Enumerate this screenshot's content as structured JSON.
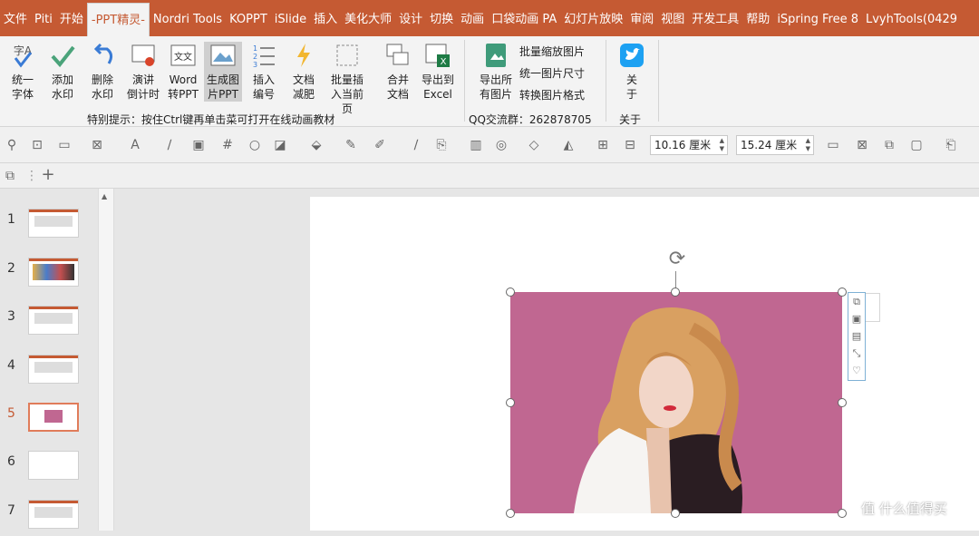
{
  "tabs": [
    {
      "label": "文件",
      "active": false
    },
    {
      "label": "Piti",
      "active": false
    },
    {
      "label": "开始",
      "active": false
    },
    {
      "label": "-PPT精灵-",
      "active": true
    },
    {
      "label": "Nordri Tools",
      "active": false
    },
    {
      "label": "KOPPT",
      "active": false
    },
    {
      "label": "iSlide",
      "active": false
    },
    {
      "label": "插入",
      "active": false
    },
    {
      "label": "美化大师",
      "active": false
    },
    {
      "label": "设计",
      "active": false
    },
    {
      "label": "切换",
      "active": false
    },
    {
      "label": "动画",
      "active": false
    },
    {
      "label": "口袋动画 PA",
      "active": false
    },
    {
      "label": "幻灯片放映",
      "active": false
    },
    {
      "label": "审阅",
      "active": false
    },
    {
      "label": "视图",
      "active": false
    },
    {
      "label": "开发工具",
      "active": false
    },
    {
      "label": "帮助",
      "active": false
    },
    {
      "label": "iSpring Free 8",
      "active": false
    },
    {
      "label": "LvyhTools(0429",
      "active": false
    }
  ],
  "ribbon": {
    "buttons": [
      {
        "l1": "统一",
        "l2": "字体",
        "icon": "unify-font-icon"
      },
      {
        "l1": "添加",
        "l2": "水印",
        "icon": "add-watermark-icon"
      },
      {
        "l1": "删除",
        "l2": "水印",
        "icon": "delete-watermark-icon"
      },
      {
        "l1": "演讲",
        "l2": "倒计时",
        "icon": "countdown-icon"
      },
      {
        "l1": "Word",
        "l2": "转PPT",
        "icon": "word-to-ppt-icon"
      },
      {
        "l1": "生成图",
        "l2": "片PPT",
        "icon": "image-ppt-icon"
      },
      {
        "l1": "插入",
        "l2": "编号",
        "icon": "insert-number-icon"
      },
      {
        "l1": "文档",
        "l2": "减肥",
        "icon": "slim-doc-icon"
      },
      {
        "l1": "批量插",
        "l2": "入当前页",
        "icon": "batch-insert-icon"
      },
      {
        "l1": "合并",
        "l2": "文档",
        "icon": "merge-doc-icon"
      },
      {
        "l1": "导出到",
        "l2": "Excel",
        "icon": "export-excel-icon"
      },
      {
        "l1": "导出所",
        "l2": "有图片",
        "icon": "export-images-icon"
      },
      {
        "l1": "关",
        "l2": "于",
        "icon": "twitter-bird-icon"
      }
    ],
    "small_items": [
      "批量缩放图片",
      "统一图片尺寸",
      "转换图片格式"
    ],
    "tip": "特别提示：按住Ctrl键再单击菜可打开在线动画教材",
    "qq": "QQ交流群：262878705",
    "about_group": "关于"
  },
  "toolbar": {
    "width": "10.16 厘米",
    "height": "15.24 厘米"
  },
  "slides": {
    "numbers": [
      "1",
      "2",
      "3",
      "4",
      "5",
      "6",
      "7"
    ],
    "active_index": 4
  },
  "watermark": "值 什么值得买",
  "colors": {
    "accent": "#c55a33",
    "photo_bg": "#c06791"
  }
}
